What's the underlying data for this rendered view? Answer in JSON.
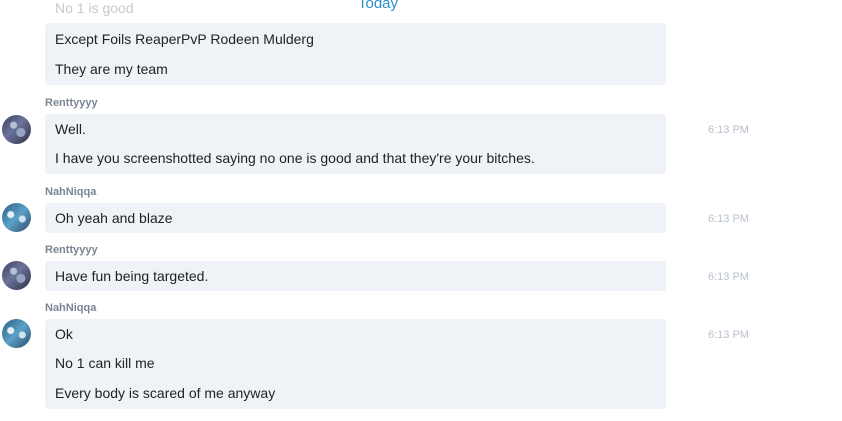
{
  "divider": {
    "label": "Today"
  },
  "faded_previous": "No 1 is good",
  "messages": [
    {
      "sender": "",
      "time": "",
      "lines": [
        "Except Foils ReaperPvP Rodeen Mulderg",
        "They are my team"
      ]
    },
    {
      "sender": "Renttyyyy",
      "time": "6:13 PM",
      "lines": [
        "Well.",
        "I have you screenshotted saying no one is good and that they're your bitches."
      ]
    },
    {
      "sender": "NahNiqqa",
      "time": "6:13 PM",
      "lines": [
        "Oh yeah and blaze"
      ]
    },
    {
      "sender": "Renttyyyy",
      "time": "6:13 PM",
      "lines": [
        "Have fun being targeted."
      ]
    },
    {
      "sender": "NahNiqqa",
      "time": "6:13 PM",
      "lines": [
        "Ok",
        "No 1 can kill me",
        "Every body is scared of me anyway"
      ]
    }
  ],
  "colors": {
    "bubble_bg": "#eff2f7",
    "divider_text": "#2a8ec8",
    "sender_text": "#7b8592",
    "timestamp_text": "#b8c1cc"
  }
}
